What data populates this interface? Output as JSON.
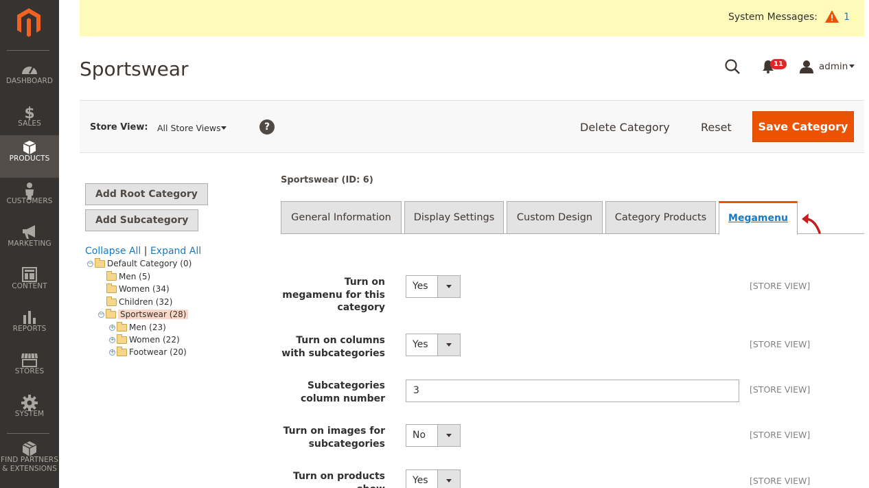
{
  "sidebar": {
    "logo": "magento-logo",
    "items": [
      {
        "label": "DASHBOARD",
        "icon": "dashboard-icon"
      },
      {
        "label": "SALES",
        "icon": "dollar-icon"
      },
      {
        "label": "PRODUCTS",
        "icon": "box-icon",
        "active": true
      },
      {
        "label": "CUSTOMERS",
        "icon": "person-icon"
      },
      {
        "label": "MARKETING",
        "icon": "megaphone-icon"
      },
      {
        "label": "CONTENT",
        "icon": "layout-icon"
      },
      {
        "label": "REPORTS",
        "icon": "bar-chart-icon"
      },
      {
        "label": "STORES",
        "icon": "storefront-icon"
      },
      {
        "label": "SYSTEM",
        "icon": "gear-icon"
      }
    ],
    "partners": {
      "line1": "FIND PARTNERS",
      "line2": "& EXTENSIONS",
      "icon": "cube-icon"
    }
  },
  "system_messages": {
    "label": "System Messages:",
    "count": "1",
    "icon": "warning-icon"
  },
  "header": {
    "title": "Sportswear",
    "notifications": "11",
    "user": "admin"
  },
  "actions": {
    "store_view_label": "Store View:",
    "store_view_value": "All Store Views",
    "help": "?",
    "delete": "Delete Category",
    "reset": "Reset",
    "save": "Save Category"
  },
  "tree": {
    "add_root": "Add Root Category",
    "add_sub": "Add Subcategory",
    "collapse_all": "Collapse All",
    "separator": "|",
    "expand_all": "Expand All",
    "nodes": [
      {
        "label": "Default Category (0)",
        "exp": "−"
      },
      {
        "label": "Men (5)"
      },
      {
        "label": "Women (34)"
      },
      {
        "label": "Children (32)"
      },
      {
        "label": "Sportswear (28)",
        "exp": "−",
        "selected": true
      },
      {
        "label": "Men (23)",
        "exp": "+"
      },
      {
        "label": "Women (22)",
        "exp": "+"
      },
      {
        "label": "Footwear (20)",
        "exp": "+"
      }
    ]
  },
  "panel": {
    "category_id": "Sportswear (ID: 6)",
    "tabs": [
      {
        "label": "General Information"
      },
      {
        "label": "Display Settings"
      },
      {
        "label": "Custom Design"
      },
      {
        "label": "Category Products"
      },
      {
        "label": "Megamenu",
        "active": true
      }
    ],
    "fields": [
      {
        "label_lines": [
          "Turn on",
          "megamenu for this",
          "category"
        ],
        "type": "select",
        "value": "Yes",
        "scope": "[STORE VIEW]"
      },
      {
        "label_lines": [
          "Turn on columns",
          "with subcategories"
        ],
        "type": "select",
        "value": "Yes",
        "scope": "[STORE VIEW]"
      },
      {
        "label_lines": [
          "Subcategories",
          "column number"
        ],
        "type": "input",
        "value": "3",
        "scope": "[STORE VIEW]"
      },
      {
        "label_lines": [
          "Turn on images for",
          "subcategories"
        ],
        "type": "select",
        "value": "No",
        "scope": "[STORE VIEW]"
      },
      {
        "label_lines": [
          "Turn on products",
          "show"
        ],
        "type": "select",
        "value": "Yes",
        "scope": "[STORE VIEW]"
      }
    ]
  },
  "colors": {
    "accent": "#eb5202",
    "sidebar": "#373330",
    "link": "#1979c3",
    "annotation_arrow": "#c41e1e"
  }
}
